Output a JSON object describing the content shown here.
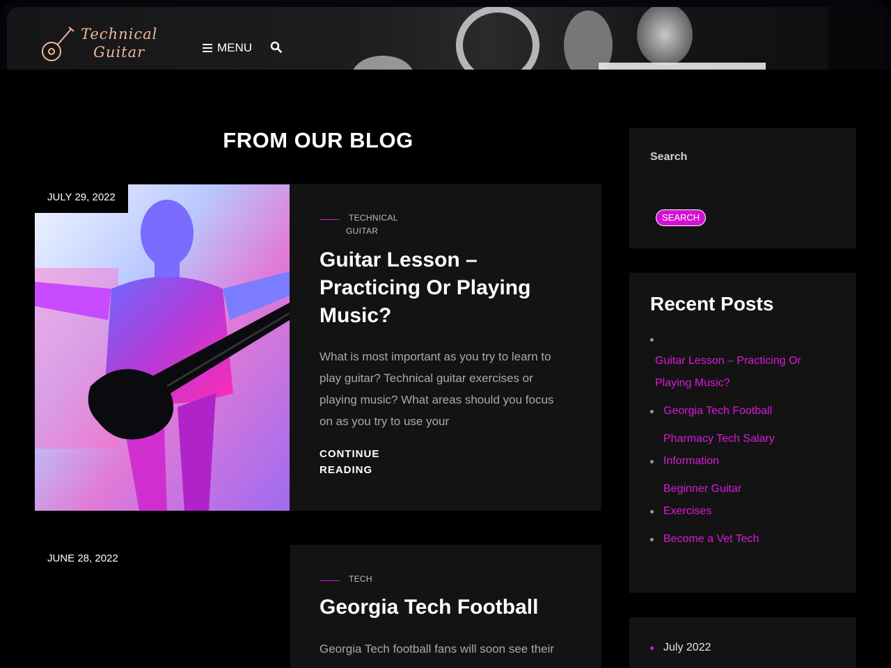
{
  "header": {
    "logo_line1": "Technical",
    "logo_line2": "Guitar",
    "menu_label": "MENU"
  },
  "main": {
    "section_title": "FROM OUR BLOG",
    "posts": [
      {
        "date": "JULY 29, 2022",
        "category_line1": "TECHNICAL",
        "category_line2": "GUITAR",
        "title_line1": "Guitar Lesson –",
        "title_line2": "Practicing Or Playing",
        "title_line3": "Music?",
        "excerpt_line1": "What is most important as you try to learn to",
        "excerpt_line2": "play guitar? Technical guitar exercises or",
        "excerpt_line3": "playing music? What areas should you focus",
        "excerpt_line4": "on as you try to use your",
        "continue_line1": "CONTINUE",
        "continue_line2": "READING"
      },
      {
        "date": "JUNE 28, 2022",
        "category": "TECH",
        "title": "Georgia Tech Football",
        "excerpt_line1": "Georgia Tech football fans will soon see their"
      }
    ]
  },
  "sidebar": {
    "search": {
      "label": "Search",
      "button": "SEARCH"
    },
    "recent_posts": {
      "title": "Recent Posts",
      "items": [
        {
          "line1": "Guitar Lesson – Practicing Or",
          "line2": "Playing Music?"
        },
        {
          "line1": "Georgia Tech Football"
        },
        {
          "line1": "Pharmacy Tech Salary",
          "line2": "Information"
        },
        {
          "line1": "Beginner Guitar",
          "line2": "Exercises"
        },
        {
          "line1": "Become a Vet Tech"
        }
      ]
    },
    "archives": {
      "items": [
        "July 2022"
      ]
    }
  },
  "colors": {
    "accent": "#d91bd9",
    "card_bg": "#131313",
    "page_bg": "#000000",
    "logo": "#f2b89a"
  }
}
